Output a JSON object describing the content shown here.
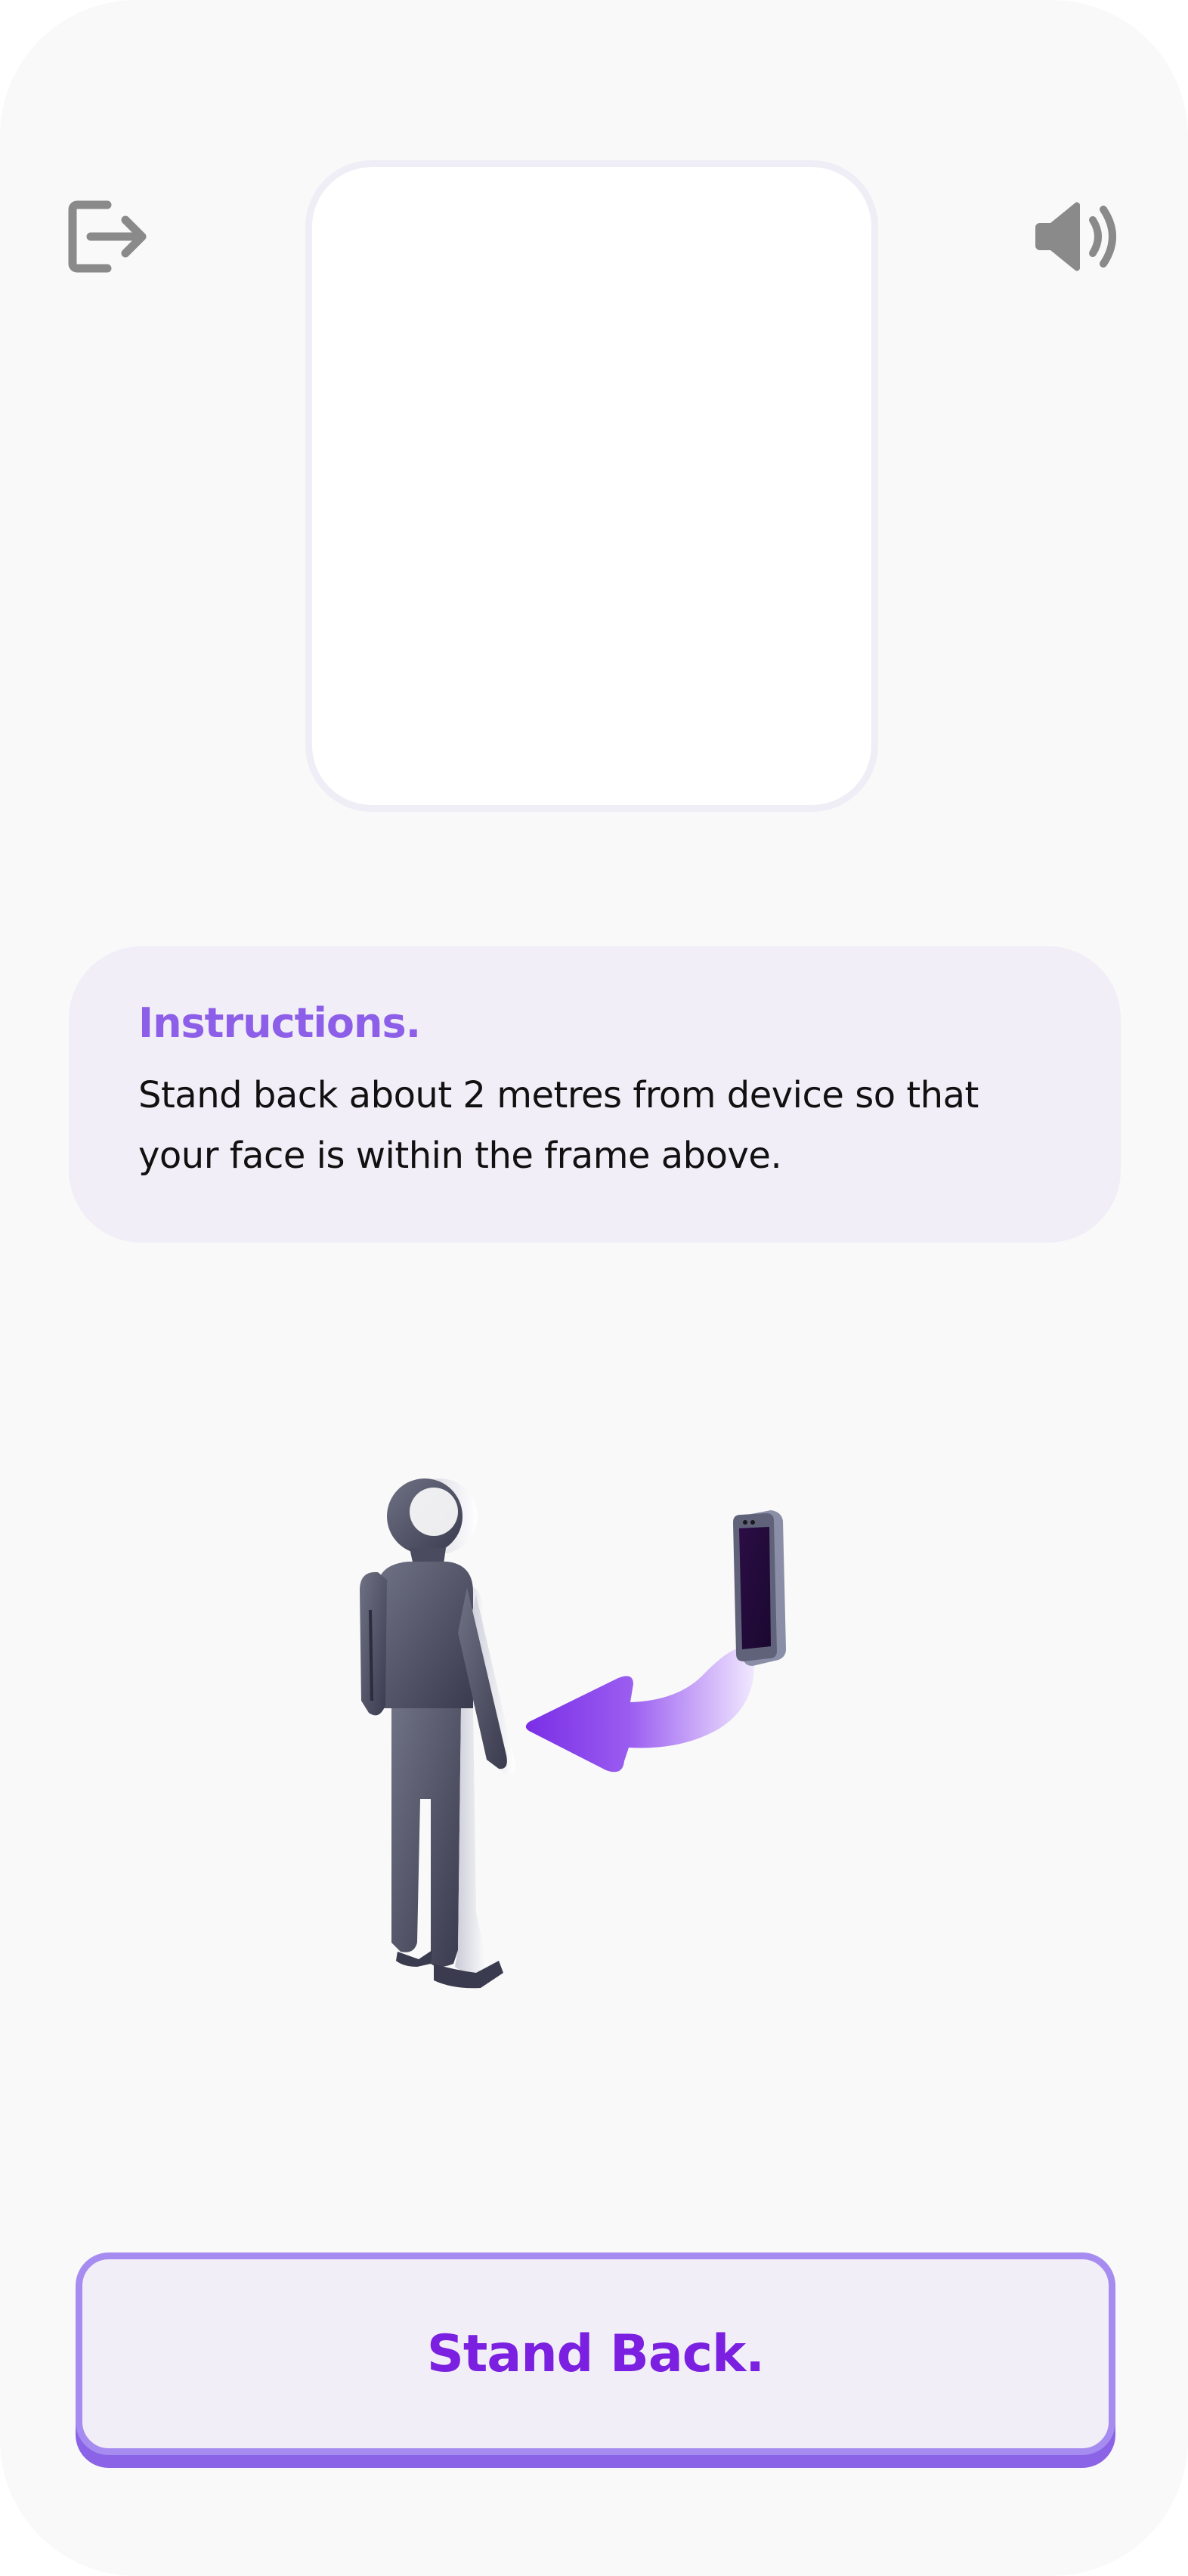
{
  "header": {
    "exit_icon": "exit-icon",
    "sound_icon": "volume-icon"
  },
  "instructions": {
    "title": "Instructions.",
    "line1": "Stand back about 2 metres from device so that",
    "line2": "your face is within the frame above."
  },
  "illustration": {
    "person": "person-figure",
    "phone": "phone-icon",
    "arrow": "arrow-left-icon"
  },
  "actions": {
    "stand_back_label": "Stand Back."
  },
  "colors": {
    "accent": "#7b1fe0",
    "accent_light": "#8d5ee8",
    "panel_bg": "#f1eef7",
    "icon_gray": "#8a8a8a"
  }
}
